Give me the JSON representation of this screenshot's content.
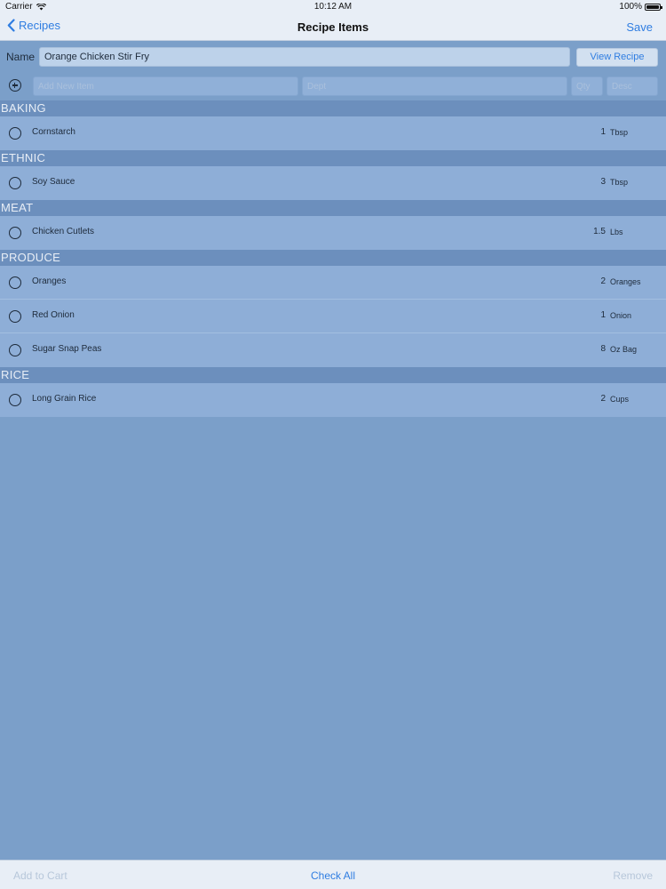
{
  "status_bar": {
    "carrier": "Carrier",
    "time": "10:12 AM",
    "battery": "100%",
    "battery_level": 1.0
  },
  "nav": {
    "back_label": "Recipes",
    "title": "Recipe Items",
    "save_label": "Save"
  },
  "name_row": {
    "label": "Name",
    "value": "Orange Chicken Stir Fry",
    "view_button": "View Recipe"
  },
  "add_row": {
    "item_placeholder": "Add New Item",
    "dept_placeholder": "Dept",
    "qty_placeholder": "Qty",
    "desc_placeholder": "Desc"
  },
  "sections": [
    {
      "title": "BAKING",
      "items": [
        {
          "name": "Cornstarch",
          "qty": "1",
          "unit": "Tbsp"
        }
      ]
    },
    {
      "title": "ETHNIC",
      "items": [
        {
          "name": "Soy Sauce",
          "qty": "3",
          "unit": "Tbsp"
        }
      ]
    },
    {
      "title": "MEAT",
      "items": [
        {
          "name": "Chicken Cutlets",
          "qty": "1.5",
          "unit": "Lbs"
        }
      ]
    },
    {
      "title": "PRODUCE",
      "items": [
        {
          "name": "Oranges",
          "qty": "2",
          "unit": "Oranges"
        },
        {
          "name": "Red Onion",
          "qty": "1",
          "unit": "Onion"
        },
        {
          "name": "Sugar Snap Peas",
          "qty": "8",
          "unit": "Oz Bag"
        }
      ]
    },
    {
      "title": "RICE",
      "items": [
        {
          "name": "Long Grain Rice",
          "qty": "2",
          "unit": "Cups"
        }
      ]
    }
  ],
  "toolbar": {
    "add_to_cart": "Add to Cart",
    "check_all": "Check All",
    "remove": "Remove"
  },
  "colors": {
    "accent": "#2f7de1",
    "background": "#7b9fc9",
    "section_header": "#6c8fbd",
    "row": "#8eaed7"
  },
  "icons": {
    "wifi": "wifi-icon",
    "back": "chevron-left-icon",
    "add": "plus-circle-icon",
    "check": "circle-outline-icon",
    "battery": "battery-icon"
  }
}
